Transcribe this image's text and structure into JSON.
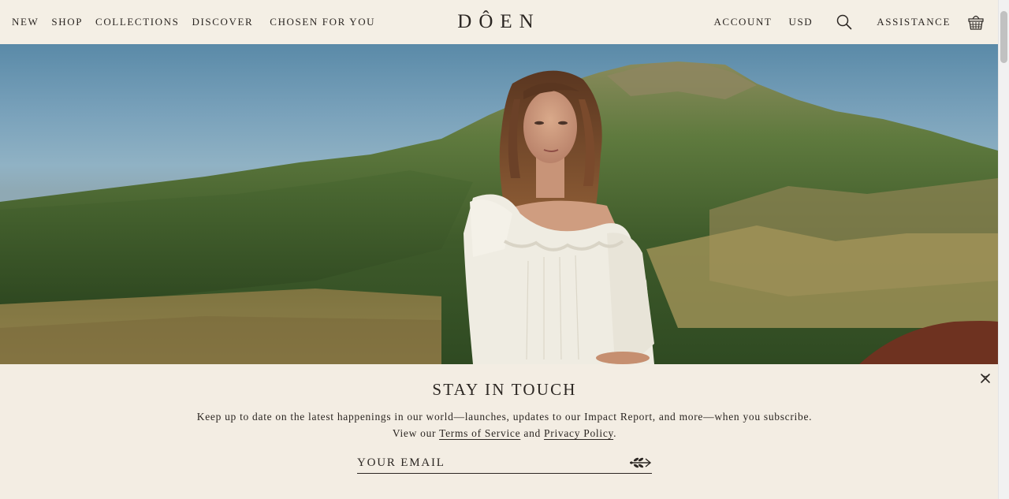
{
  "header": {
    "nav_left": [
      {
        "label": "NEW"
      },
      {
        "label": "SHOP"
      },
      {
        "label": "COLLECTIONS"
      },
      {
        "label": "DISCOVER"
      },
      {
        "label": "CHOSEN FOR YOU"
      }
    ],
    "logo": "DÔEN",
    "account_label": "ACCOUNT",
    "currency_label": "USD",
    "search_icon": "search-icon",
    "assistance_label": "ASSISTANCE",
    "basket_icon": "basket-icon"
  },
  "hero": {
    "image": "woman-in-white-dress-mountain-landscape"
  },
  "newsletter": {
    "title": "STAY IN TOUCH",
    "description": "Keep up to date on the latest happenings in our world—launches, updates to our Impact Report, and more—when you subscribe.",
    "view_our": "View our",
    "terms_label": "Terms of Service",
    "and": "and",
    "privacy_label": "Privacy Policy",
    "period": ".",
    "email_placeholder": "YOUR EMAIL",
    "submit_icon": "olive-branch-arrow-icon",
    "close_icon": "close-icon"
  },
  "colors": {
    "background": "#f3ede3",
    "text": "#2b2622"
  }
}
